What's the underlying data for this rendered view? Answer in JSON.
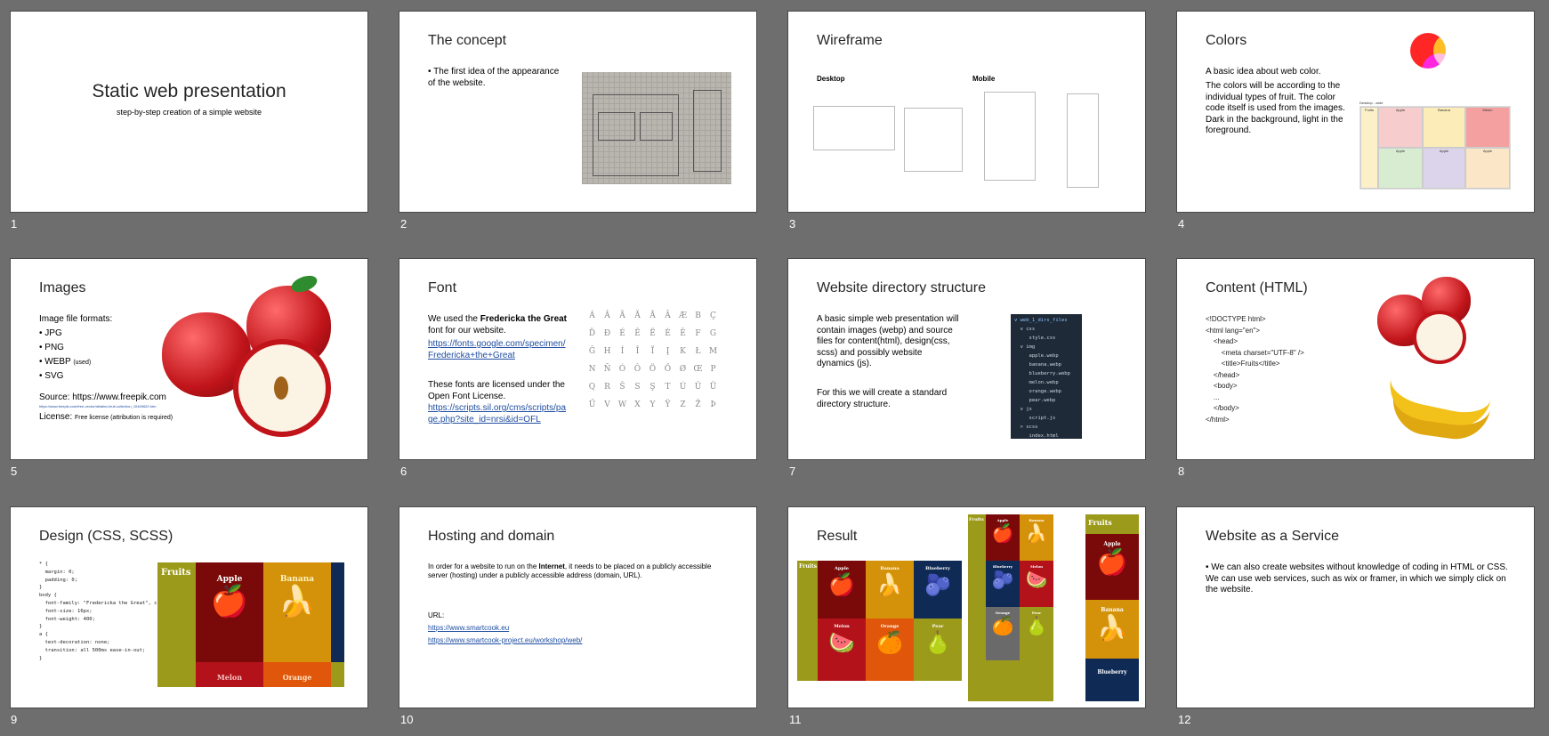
{
  "slides": [
    {
      "num": "1",
      "title": "Static web presentation",
      "subtitle": "step-by-step creation of a simple website"
    },
    {
      "num": "2",
      "title": "The concept",
      "bullet": "• The first idea of the appearance of the website."
    },
    {
      "num": "3",
      "title": "Wireframe",
      "desktop": "Desktop",
      "mobile": "Mobile"
    },
    {
      "num": "4",
      "title": "Colors",
      "line1": "A basic idea about web color.",
      "line2": "The colors will be according to the individual types of fruit. The color code itself is used from the images. Dark in the background, light in the foreground.",
      "grid_label": "Desktop - wide",
      "fruits": [
        "Fruits",
        "Apple",
        "Banana",
        "Melon",
        "Apple",
        "Apple",
        "Apple"
      ],
      "image": "Image"
    },
    {
      "num": "5",
      "title": "Images",
      "formats_label": "Image file formats:",
      "formats": [
        "• JPG",
        "• PNG",
        "• WEBP",
        "• SVG"
      ],
      "webp_note": "(used)",
      "source": "Source: https://www.freepik.com",
      "source_small": "https://www.freepik.com/free-vector/detailed-fruit-collection_10469620.htm",
      "license_label": "License:",
      "license_value": "Free license (attribution is required)"
    },
    {
      "num": "6",
      "title": "Font",
      "p1a": "We used the ",
      "p1b": "Fredericka the Great",
      "p1c": " font for our website.",
      "link1": "https://fonts.google.com/specimen/Fredericka+the+Great",
      "p2": "These fonts are licensed under the Open Font License.",
      "link2": "https://scripts.sil.org/cms/scripts/page.php?site_id=nrsi&id=OFL",
      "glyphs": [
        "Á",
        "Â",
        "Ä",
        "Ă",
        "Ã",
        "Ā",
        "Æ",
        "B",
        "Ç",
        "Ď",
        "Đ",
        "É",
        "Ê",
        "Ë",
        "Ė",
        "Ē",
        "F",
        "G",
        "Ğ",
        "H",
        "Í",
        "Î",
        "Ï",
        "Į",
        "K",
        "Ł",
        "M",
        "N",
        "Ñ",
        "Ó",
        "Ô",
        "Ö",
        "Ő",
        "Ø",
        "Œ",
        "P",
        "Q",
        "R",
        "Š",
        "S",
        "Ş",
        "T",
        "Ú",
        "Û",
        "Ü",
        "Ű",
        "V",
        "W",
        "X",
        "Y",
        "Ÿ",
        "Z",
        "Ž",
        "Þ"
      ]
    },
    {
      "num": "7",
      "title": "Website directory structure",
      "p1": "A basic simple web presentation will contain images (webp) and source files for content(html), design(css, scss) and possibly website dynamics (js).",
      "p2": "For this we will create a standard directory structure.",
      "tree": [
        "v web_1_dirs_files",
        "  v css",
        "     style.css",
        "  v img",
        "     apple.webp",
        "     banana.webp",
        "     blueberry.webp",
        "     melon.webp",
        "     orange.webp",
        "     pear.webp",
        "  v js",
        "     script.js",
        "  > scss",
        "     index.html"
      ]
    },
    {
      "num": "8",
      "title": "Content (HTML)",
      "code": [
        "<!DOCTYPE html>",
        "<html lang=\"en\">",
        "    <head>",
        "        <meta charset=\"UTF-8\" />",
        "        <title>Fruits</title>",
        "    </head>",
        "    <body>",
        "    ...",
        "    </body>",
        "</html>"
      ]
    },
    {
      "num": "9",
      "title": "Design (CSS, SCSS)",
      "code": [
        "* {",
        "  margin: 0;",
        "  padding: 0;",
        "}",
        "body {",
        "  font-family: \"Fredericka the Great\", cursive;",
        "  font-size: 16px;",
        "  font-weight: 400;",
        "}",
        "a {",
        "  text-decoration: none;",
        "  transition: all 500ms ease-in-out;",
        "}"
      ],
      "labels": [
        "Fruits",
        "Apple",
        "Banana",
        "Melon",
        "Orange"
      ]
    },
    {
      "num": "10",
      "title": "Hosting and domain",
      "p1a": "In order for a website to run on the ",
      "p1b": "Internet",
      "p1c": ", it needs to be placed on a publicly accessible server (hosting) under a publicly accessible address (domain, URL).",
      "url_label": "URL:",
      "link1": "https://www.smartcook.eu",
      "link2": "https://www.smartcook-project.eu/workshop/web/"
    },
    {
      "num": "11",
      "title": "Result",
      "wide": [
        "Fruits",
        "Apple",
        "Banana",
        "Blueberry",
        "Melon",
        "Orange",
        "Pear"
      ],
      "mid": [
        "Fruits",
        "Apple",
        "Banana",
        "Blueberry",
        "Melon",
        "Orange",
        "Pear"
      ],
      "narrow": [
        "Fruits",
        "Apple",
        "Banana",
        "Blueberry"
      ]
    },
    {
      "num": "12",
      "title": "Website as a Service",
      "bullet": "• We can also create websites without knowledge of coding in HTML or CSS. We can use web services, such as wix or framer, in which we simply click on the website."
    }
  ],
  "colors": {
    "apple": "#7a0a0a",
    "banana": "#d4920a",
    "olive": "#9c9a1a",
    "blue": "#0f2a55",
    "orange": "#e0560a",
    "melon": "#b3121a",
    "gray": "#6a6a6a"
  }
}
